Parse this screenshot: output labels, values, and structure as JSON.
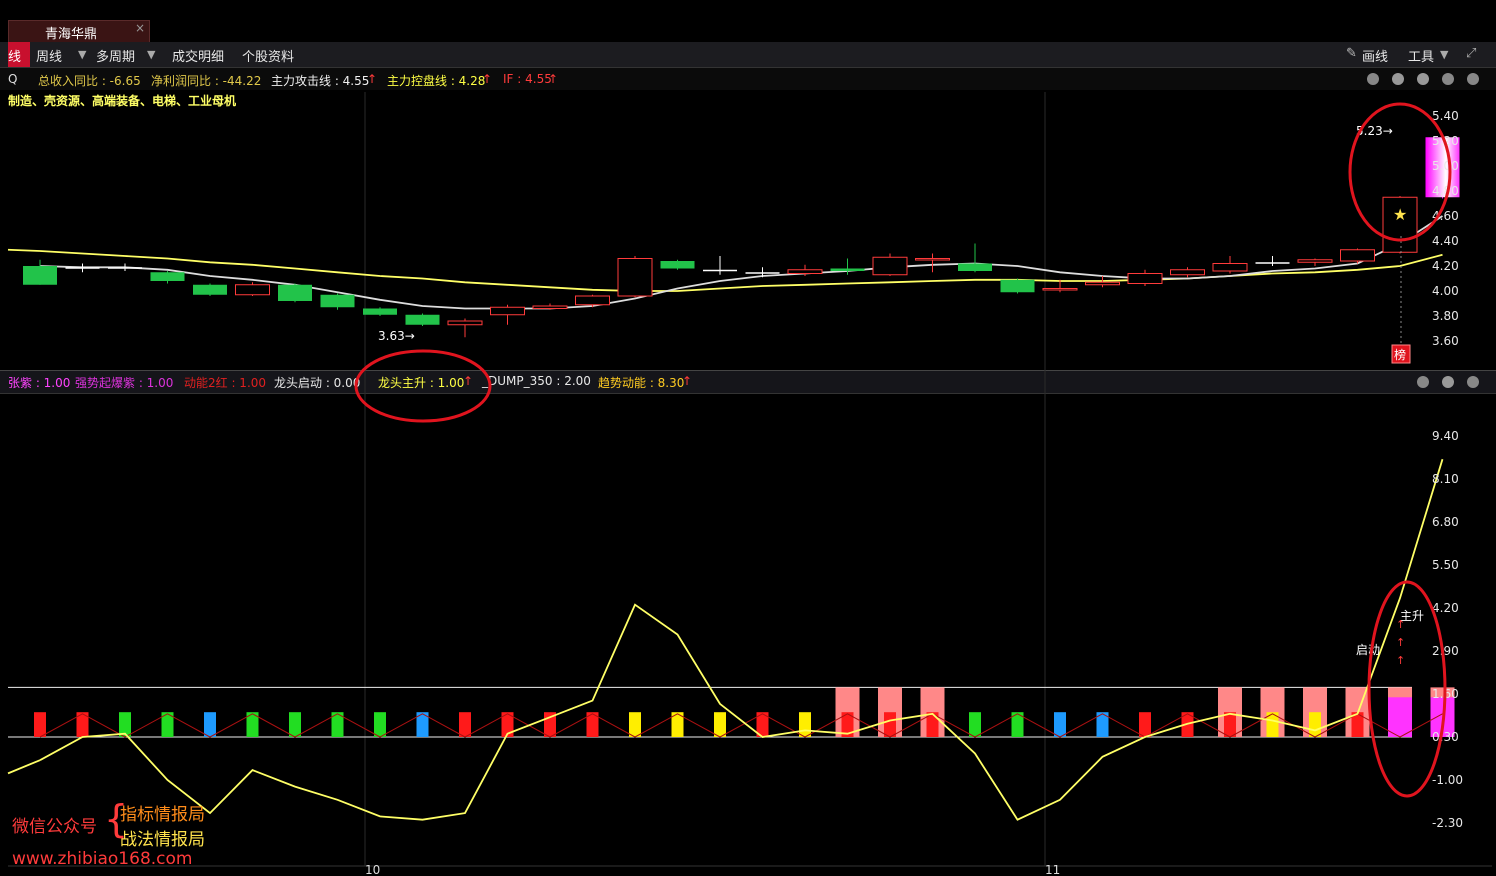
{
  "tab": {
    "title": "青海华鼎",
    "close": "×"
  },
  "toolbar": {
    "active": "线",
    "items": [
      "周线",
      "多周期",
      "成交明细",
      "个股资料"
    ],
    "right_draw": "画线",
    "right_tools": "工具"
  },
  "info": {
    "prefix": "Q",
    "revenue": "总收入同比 : -6.65",
    "profit": "净利润同比 : -44.22",
    "attack": "主力攻击线 : 4.55",
    "control": "主力控盘线 : 4.28",
    "if": "IF : 4.55",
    "up_arrow": "↑"
  },
  "sectors": "制造、壳资源、高端装备、电梯、工业母机",
  "upper_axis": [
    "5.40",
    "5.20",
    "5.00",
    "4.80",
    "4.60",
    "4.40",
    "4.20",
    "4.00",
    "3.80",
    "3.60"
  ],
  "upper_annotations": {
    "high": "5.23",
    "low": "3.63",
    "badge": "榜"
  },
  "indicator_bar": {
    "i1": "张紫 : 1.00",
    "i2": "强势起爆紫 : 1.00",
    "i3": "动能2红 : 1.00",
    "i4": "龙头启动 : 0.00",
    "i5": "龙头主升 : 1.00",
    "i6": "_DUMP_350 : 2.00",
    "i7": "趋势动能 : 8.30"
  },
  "lower_axis": [
    "9.40",
    "8.10",
    "6.80",
    "5.50",
    "4.20",
    "2.90",
    "1.60",
    "0.30",
    "-1.00",
    "-2.30"
  ],
  "lower_annotations": {
    "launch": "启动",
    "main": "主升"
  },
  "x_axis": [
    "10",
    "11"
  ],
  "watermark": {
    "wechat": "微信公众号",
    "brace": "{",
    "line1": "指标情报局",
    "line2": "战法情报局",
    "url": "www.zhibiao168.com"
  },
  "colors": {
    "up": "#ff3b3b",
    "down": "#22c34a",
    "ma_yellow": "#ffff66",
    "ma_white": "#ffffff",
    "highlight": "#ff00ff",
    "circle": "#e0141e"
  },
  "chart_data": [
    {
      "type": "candlestick",
      "y_range": [
        3.5,
        5.5
      ],
      "candles": [
        {
          "o": 4.2,
          "c": 4.05,
          "h": 4.25,
          "l": 4.05
        },
        {
          "o": 4.19,
          "c": 4.19,
          "h": 4.22,
          "l": 4.15
        },
        {
          "o": 4.19,
          "c": 4.19,
          "h": 4.22,
          "l": 4.16
        },
        {
          "o": 4.15,
          "c": 4.08,
          "h": 4.16,
          "l": 4.06
        },
        {
          "o": 4.05,
          "c": 3.97,
          "h": 4.06,
          "l": 3.96
        },
        {
          "o": 3.97,
          "c": 4.05,
          "h": 4.07,
          "l": 3.96
        },
        {
          "o": 4.05,
          "c": 3.92,
          "h": 4.06,
          "l": 3.91
        },
        {
          "o": 3.97,
          "c": 3.87,
          "h": 3.98,
          "l": 3.85
        },
        {
          "o": 3.86,
          "c": 3.81,
          "h": 3.87,
          "l": 3.8
        },
        {
          "o": 3.81,
          "c": 3.73,
          "h": 3.82,
          "l": 3.72
        },
        {
          "o": 3.73,
          "c": 3.76,
          "h": 3.78,
          "l": 3.63
        },
        {
          "o": 3.81,
          "c": 3.87,
          "h": 3.89,
          "l": 3.73
        },
        {
          "o": 3.86,
          "c": 3.88,
          "h": 3.9,
          "l": 3.85
        },
        {
          "o": 3.89,
          "c": 3.96,
          "h": 3.97,
          "l": 3.87
        },
        {
          "o": 3.96,
          "c": 4.26,
          "h": 4.28,
          "l": 3.95
        },
        {
          "o": 4.24,
          "c": 4.18,
          "h": 4.25,
          "l": 4.17
        },
        {
          "o": 4.17,
          "c": 4.17,
          "h": 4.28,
          "l": 4.13
        },
        {
          "o": 4.15,
          "c": 4.15,
          "h": 4.19,
          "l": 4.11
        },
        {
          "o": 4.14,
          "c": 4.17,
          "h": 4.21,
          "l": 4.12
        },
        {
          "o": 4.18,
          "c": 4.16,
          "h": 4.26,
          "l": 4.13
        },
        {
          "o": 4.13,
          "c": 4.27,
          "h": 4.3,
          "l": 4.12
        },
        {
          "o": 4.25,
          "c": 4.26,
          "h": 4.3,
          "l": 4.15
        },
        {
          "o": 4.22,
          "c": 4.16,
          "h": 4.38,
          "l": 4.15
        },
        {
          "o": 4.09,
          "c": 3.99,
          "h": 4.1,
          "l": 3.98
        },
        {
          "o": 4.01,
          "c": 4.02,
          "h": 4.09,
          "l": 3.99
        },
        {
          "o": 4.05,
          "c": 4.07,
          "h": 4.12,
          "l": 4.03
        },
        {
          "o": 4.06,
          "c": 4.14,
          "h": 4.17,
          "l": 4.04
        },
        {
          "o": 4.13,
          "c": 4.17,
          "h": 4.19,
          "l": 4.11
        },
        {
          "o": 4.16,
          "c": 4.22,
          "h": 4.28,
          "l": 4.14
        },
        {
          "o": 4.23,
          "c": 4.23,
          "h": 4.28,
          "l": 4.2
        },
        {
          "o": 4.23,
          "c": 4.25,
          "h": 4.26,
          "l": 4.2
        },
        {
          "o": 4.24,
          "c": 4.33,
          "h": 4.34,
          "l": 4.22
        },
        {
          "o": 4.31,
          "c": 4.75,
          "h": 4.76,
          "l": 4.3
        },
        {
          "o": 4.75,
          "c": 5.23,
          "h": 5.23,
          "l": 4.74,
          "highlight": true
        }
      ],
      "ma_yellow": [
        4.32,
        4.3,
        4.28,
        4.26,
        4.23,
        4.21,
        4.18,
        4.15,
        4.12,
        4.1,
        4.07,
        4.05,
        4.03,
        4.01,
        4.0,
        4.0,
        4.02,
        4.04,
        4.05,
        4.06,
        4.07,
        4.08,
        4.09,
        4.09,
        4.08,
        4.08,
        4.09,
        4.1,
        4.12,
        4.14,
        4.15,
        4.17,
        4.2,
        4.29
      ],
      "ma_white": [
        4.2,
        4.19,
        4.19,
        4.17,
        4.12,
        4.09,
        4.05,
        3.99,
        3.93,
        3.88,
        3.86,
        3.86,
        3.86,
        3.88,
        3.94,
        4.02,
        4.08,
        4.12,
        4.14,
        4.16,
        4.19,
        4.21,
        4.22,
        4.2,
        4.15,
        4.12,
        4.1,
        4.1,
        4.12,
        4.16,
        4.18,
        4.22,
        4.38,
        4.6
      ]
    },
    {
      "type": "bar+line",
      "y_range": [
        -2.8,
        9.9
      ],
      "trend_line": [
        -0.4,
        0.3,
        0.4,
        -1.0,
        -2.0,
        -0.7,
        -1.2,
        -1.6,
        -2.1,
        -2.2,
        -2.0,
        0.4,
        0.9,
        1.4,
        4.3,
        3.4,
        1.3,
        0.3,
        0.5,
        0.4,
        0.8,
        1.0,
        -0.2,
        -2.2,
        -1.6,
        -0.3,
        0.3,
        0.7,
        1.0,
        0.8,
        0.5,
        1.0,
        4.5,
        8.7
      ],
      "bar_colors": [
        "red",
        "red",
        "green",
        "green",
        "blue",
        "green",
        "green",
        "green",
        "green",
        "blue",
        "red",
        "red",
        "red",
        "red",
        "yellow",
        "yellow",
        "yellow",
        "red",
        "yellow",
        "red",
        "red",
        "red",
        "green",
        "green",
        "blue",
        "blue",
        "red",
        "red",
        "red",
        "yellow",
        "yellow",
        "red",
        "magenta",
        "magenta"
      ],
      "tall_pink": [
        false,
        false,
        false,
        false,
        false,
        false,
        false,
        false,
        false,
        false,
        false,
        false,
        false,
        false,
        false,
        false,
        false,
        false,
        false,
        true,
        true,
        true,
        false,
        false,
        false,
        false,
        false,
        false,
        true,
        true,
        true,
        true,
        true,
        true
      ],
      "level_lines": [
        0.3,
        1.8
      ]
    }
  ]
}
